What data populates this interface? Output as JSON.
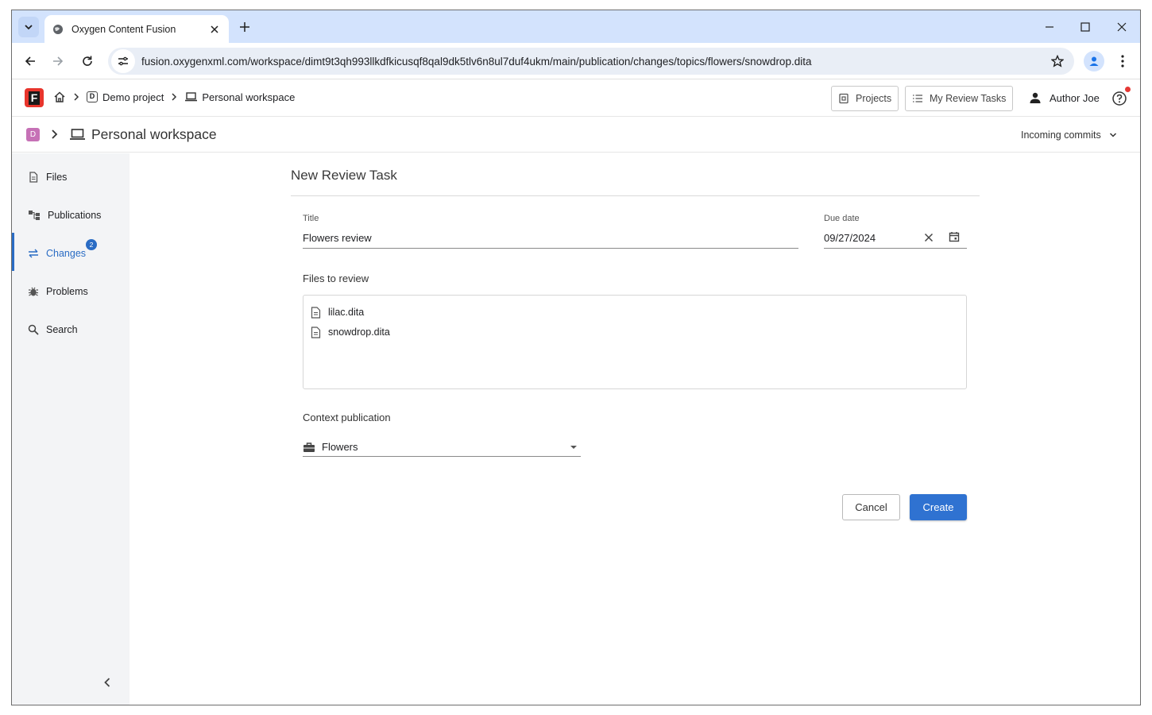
{
  "browser": {
    "tab_title": "Oxygen Content Fusion",
    "url": "fusion.oxygenxml.com/workspace/dimt9t3qh993llkdfkicusqf8qal9dk5tlv6n8ul7duf4ukm/main/publication/changes/topics/flowers/snowdrop.dita"
  },
  "header": {
    "logo_letter": "F",
    "breadcrumb": {
      "project_badge": "D",
      "project": "Demo project",
      "workspace": "Personal workspace"
    },
    "projects_label": "Projects",
    "review_tasks_label": "My Review Tasks",
    "user_name": "Author Joe"
  },
  "workspace_bar": {
    "badge": "D",
    "title": "Personal workspace",
    "incoming": "Incoming commits"
  },
  "sidebar": {
    "items": [
      {
        "label": "Files",
        "icon": "file-icon"
      },
      {
        "label": "Publications",
        "icon": "publications-icon"
      },
      {
        "label": "Changes",
        "icon": "changes-icon",
        "badge": "2",
        "active": true
      },
      {
        "label": "Problems",
        "icon": "bug-icon"
      },
      {
        "label": "Search",
        "icon": "search-icon"
      }
    ]
  },
  "form": {
    "heading": "New Review Task",
    "title_label": "Title",
    "title_value": "Flowers review",
    "due_label": "Due date",
    "due_value": "09/27/2024",
    "files_label": "Files to review",
    "files": [
      "lilac.dita",
      "snowdrop.dita"
    ],
    "context_label": "Context publication",
    "context_value": "Flowers",
    "cancel_label": "Cancel",
    "create_label": "Create"
  },
  "colors": {
    "accent": "#2f72d1",
    "tabstrip": "#d3e3fd",
    "workspace_badge": "#c671b6",
    "logo": "#e8352c"
  }
}
